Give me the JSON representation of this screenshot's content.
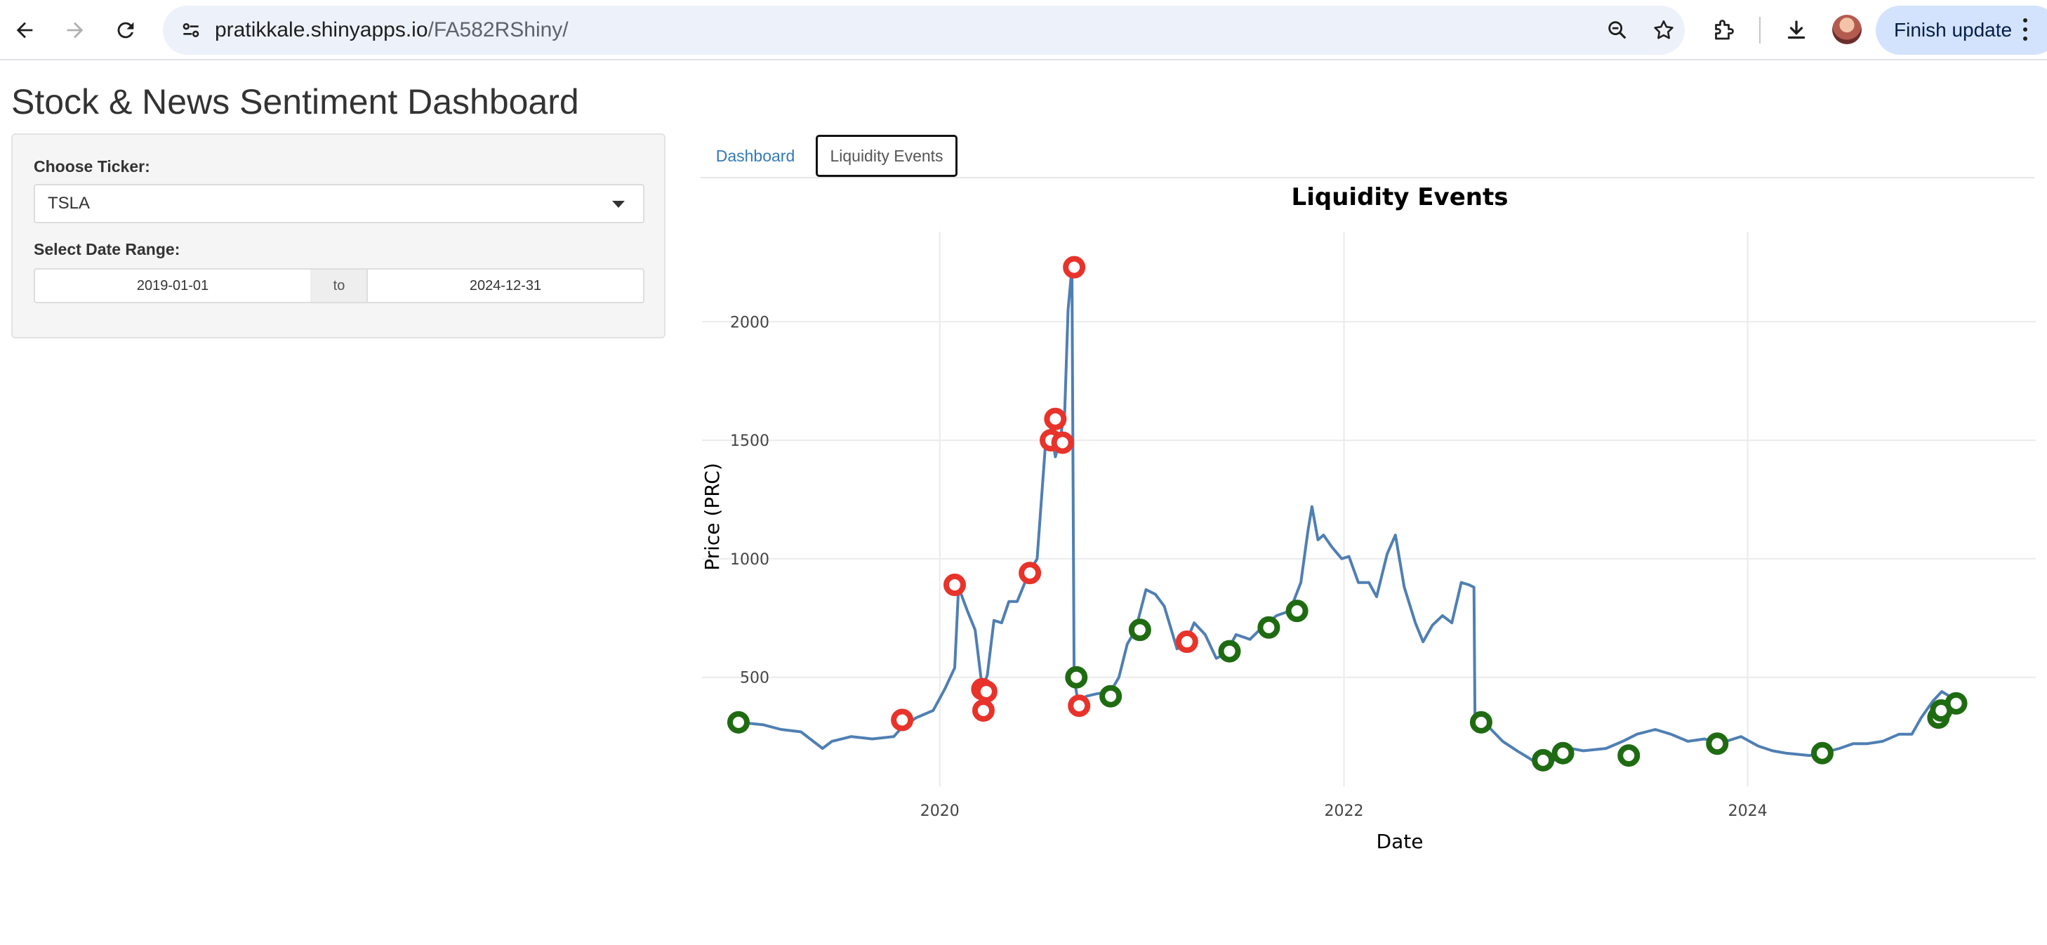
{
  "browser": {
    "url_host": "pratikkale.shinyapps.io",
    "url_path": "/FA582RShiny/",
    "update_button": "Finish update",
    "icons": [
      "back-icon",
      "forward-icon",
      "reload-icon",
      "site-info-icon",
      "zoom-icon",
      "star-icon",
      "extensions-icon",
      "download-icon",
      "avatar",
      "menu-icon"
    ]
  },
  "app": {
    "title": "Stock & News Sentiment Dashboard",
    "ticker_label": "Choose Ticker:",
    "ticker_value": "TSLA",
    "date_label": "Select Date Range:",
    "date_start": "2019-01-01",
    "date_sep": "to",
    "date_end": "2024-12-31",
    "tabs": [
      {
        "label": "Dashboard",
        "active": false
      },
      {
        "label": "Liquidity Events",
        "active": true
      }
    ]
  },
  "chart_data": {
    "type": "line",
    "title": "Liquidity Events",
    "xlabel": "Date",
    "ylabel": "Price (PRC)",
    "x_ticks": [
      "2020",
      "2022",
      "2024"
    ],
    "y_ticks": [
      500,
      1000,
      1500,
      2000
    ],
    "xlim": [
      "2018-10-28",
      "2025-06-05"
    ],
    "ylim": [
      40,
      2380
    ],
    "grid": true,
    "colors": {
      "line": "#4f7fb3",
      "negative_event": "#e8332a",
      "positive_event": "#1f6b12"
    },
    "series": [
      {
        "x": [
          "2019-01-02",
          "2019-02-15",
          "2019-03-20",
          "2019-04-25",
          "2019-06-03",
          "2019-06-20",
          "2019-07-25",
          "2019-09-01",
          "2019-10-10",
          "2019-10-25",
          "2019-11-20",
          "2019-12-20",
          "2020-01-10",
          "2020-01-28",
          "2020-02-04",
          "2020-02-20",
          "2020-03-05",
          "2020-03-18",
          "2020-03-27",
          "2020-04-08",
          "2020-04-22",
          "2020-05-05",
          "2020-05-20",
          "2020-06-10",
          "2020-06-25",
          "2020-07-10",
          "2020-07-20",
          "2020-07-28",
          "2020-08-05",
          "2020-08-14",
          "2020-08-20",
          "2020-08-27",
          "2020-08-31",
          "2020-09-08",
          "2020-09-22",
          "2020-10-10",
          "2020-11-05",
          "2020-11-20",
          "2020-12-05",
          "2020-12-20",
          "2021-01-08",
          "2021-01-25",
          "2021-02-10",
          "2021-03-05",
          "2021-03-20",
          "2021-04-05",
          "2021-04-25",
          "2021-05-15",
          "2021-06-01",
          "2021-06-20",
          "2021-07-15",
          "2021-08-10",
          "2021-09-01",
          "2021-09-25",
          "2021-10-15",
          "2021-10-28",
          "2021-11-04",
          "2021-11-15",
          "2021-11-25",
          "2021-12-10",
          "2021-12-28",
          "2022-01-10",
          "2022-01-27",
          "2022-02-15",
          "2022-03-01",
          "2022-03-20",
          "2022-04-04",
          "2022-04-20",
          "2022-05-10",
          "2022-05-24",
          "2022-06-10",
          "2022-06-28",
          "2022-07-15",
          "2022-08-01",
          "2022-08-15",
          "2022-08-24",
          "2022-08-26",
          "2022-09-20",
          "2022-10-15",
          "2022-11-10",
          "2022-12-01",
          "2022-12-20",
          "2023-01-05",
          "2023-01-26",
          "2023-02-15",
          "2023-03-10",
          "2023-04-20",
          "2023-05-20",
          "2023-06-15",
          "2023-07-18",
          "2023-08-15",
          "2023-09-15",
          "2023-10-15",
          "2023-11-10",
          "2023-12-20",
          "2024-01-20",
          "2024-02-15",
          "2024-03-10",
          "2024-04-22",
          "2024-05-15",
          "2024-06-15",
          "2024-07-10",
          "2024-08-05",
          "2024-09-01",
          "2024-10-01",
          "2024-10-24",
          "2024-11-10",
          "2024-12-01",
          "2024-12-17",
          "2024-12-31"
        ],
        "y": [
          310,
          300,
          280,
          270,
          200,
          230,
          250,
          240,
          250,
          290,
          330,
          360,
          450,
          540,
          880,
          780,
          700,
          450,
          510,
          740,
          730,
          820,
          820,
          940,
          1000,
          1480,
          1550,
          1430,
          1500,
          1620,
          2050,
          2230,
          500,
          380,
          420,
          430,
          440,
          500,
          640,
          700,
          870,
          850,
          800,
          620,
          640,
          730,
          680,
          580,
          600,
          680,
          660,
          720,
          760,
          780,
          900,
          1120,
          1220,
          1080,
          1100,
          1050,
          1000,
          1010,
          900,
          900,
          840,
          1020,
          1100,
          880,
          730,
          650,
          720,
          760,
          730,
          900,
          890,
          880,
          300,
          290,
          230,
          190,
          160,
          130,
          120,
          180,
          200,
          190,
          200,
          230,
          260,
          280,
          260,
          230,
          240,
          220,
          250,
          210,
          190,
          180,
          170,
          180,
          200,
          220,
          220,
          230,
          260,
          260,
          330,
          400,
          440,
          420
        ]
      }
    ],
    "events": {
      "negative": [
        [
          "2019-10-25",
          320
        ],
        [
          "2020-01-28",
          890
        ],
        [
          "2020-03-18",
          450
        ],
        [
          "2020-03-20",
          360
        ],
        [
          "2020-03-25",
          440
        ],
        [
          "2020-06-12",
          940
        ],
        [
          "2020-07-20",
          1500
        ],
        [
          "2020-07-28",
          1590
        ],
        [
          "2020-08-10",
          1490
        ],
        [
          "2020-08-31",
          2230
        ],
        [
          "2020-09-09",
          380
        ],
        [
          "2021-03-23",
          650
        ]
      ],
      "positive": [
        [
          "2019-01-02",
          310
        ],
        [
          "2020-09-04",
          500
        ],
        [
          "2020-11-05",
          420
        ],
        [
          "2020-12-28",
          700
        ],
        [
          "2021-06-08",
          610
        ],
        [
          "2021-08-18",
          710
        ],
        [
          "2021-10-08",
          780
        ],
        [
          "2022-09-06",
          310
        ],
        [
          "2022-12-27",
          150
        ],
        [
          "2023-02-01",
          180
        ],
        [
          "2023-05-31",
          170
        ],
        [
          "2023-11-07",
          220
        ],
        [
          "2024-05-15",
          180
        ],
        [
          "2024-12-11",
          330
        ],
        [
          "2024-12-16",
          360
        ],
        [
          "2025-01-12",
          390
        ]
      ]
    }
  }
}
